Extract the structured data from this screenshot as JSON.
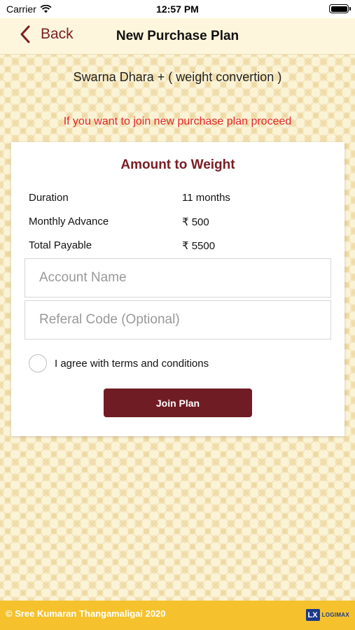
{
  "status_bar": {
    "carrier": "Carrier",
    "time": "12:57 PM"
  },
  "nav": {
    "back_label": "Back",
    "title": "New Purchase Plan"
  },
  "plan": {
    "name": "Swarna Dhara + ( weight convertion )",
    "message": "If you want to join new purchase plan proceed"
  },
  "card": {
    "title": "Amount to Weight",
    "rows": [
      {
        "label": "Duration",
        "value": "11 months"
      },
      {
        "label": "Monthly Advance",
        "value": "₹ 500"
      },
      {
        "label": "Total Payable",
        "value": "₹ 5500"
      }
    ],
    "account_name": {
      "value": "",
      "placeholder": "Account Name"
    },
    "referral_code": {
      "value": "",
      "placeholder": "Referal Code (Optional)"
    },
    "terms_label": "I agree with terms and conditions",
    "terms_checked": false,
    "join_label": "Join Plan"
  },
  "footer": {
    "copyright": "© Sree Kumaran Thangamaligai 2020",
    "logo_mark": "LX",
    "logo_text": "LOGIMAX"
  },
  "colors": {
    "brand": "#7b1d24",
    "button": "#6f1c25",
    "message": "#e0282e",
    "footer": "#f5c22e",
    "background": "#fbf3d6"
  },
  "icons": {
    "back": "chevron-left-icon",
    "wifi": "wifi-icon",
    "battery": "battery-icon"
  }
}
